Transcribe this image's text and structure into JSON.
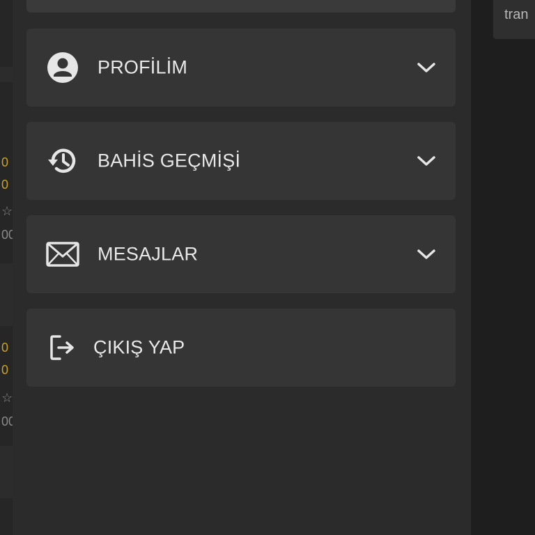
{
  "menu": {
    "items": [
      {
        "label": "PROFİLİM",
        "icon": "account-circle-icon"
      },
      {
        "label": "BAHİS GEÇMİŞİ",
        "icon": "history-icon"
      },
      {
        "label": "MESAJLAR",
        "icon": "envelope-icon"
      },
      {
        "label": "ÇIKIŞ YAP",
        "icon": "logout-icon"
      }
    ]
  },
  "background": {
    "right_card_text": "tran",
    "left_fragments": [
      "0",
      "0",
      "☆",
      "00",
      "0",
      "0",
      "☆",
      "00"
    ]
  },
  "colors": {
    "drawer_bg": "#2b2b2b",
    "item_bg": "#353535",
    "text": "#e8e8e8",
    "page_bg": "#1f1f1f",
    "accent": "#c9a227"
  }
}
